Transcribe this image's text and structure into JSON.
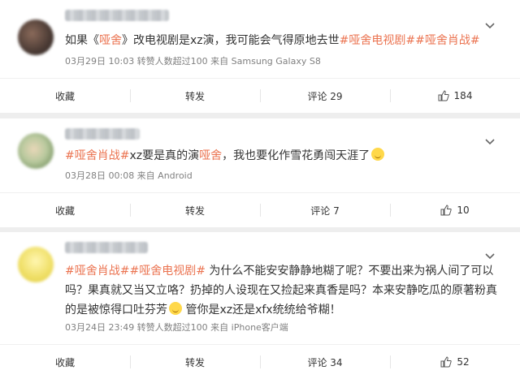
{
  "colors": {
    "tag": "#eb7350",
    "text": "#333333",
    "meta": "#808080"
  },
  "posts": [
    {
      "segments": [
        {
          "t": "如果《",
          "tag": false
        },
        {
          "t": "哑舍",
          "tag": true
        },
        {
          "t": "》改电视剧是xz演，我可能会气得原地去世",
          "tag": false
        },
        {
          "t": "#哑舍电视剧##哑舍肖战#",
          "tag": true
        }
      ],
      "meta": "03月29日 10:03 转赞人数超过100   来自 Samsung Galaxy S8",
      "actions": {
        "fav": "收藏",
        "repost": "转发",
        "comment": "评论 29",
        "like": "184"
      }
    },
    {
      "segments": [
        {
          "t": "#哑舍肖战#",
          "tag": true
        },
        {
          "t": "xz要是真的演",
          "tag": false
        },
        {
          "t": "哑舍",
          "tag": true
        },
        {
          "t": "，我也要化作雪花勇闯天涯了",
          "tag": false
        }
      ],
      "meta": "03月28日 00:08  来自 Android",
      "actions": {
        "fav": "收藏",
        "repost": "转发",
        "comment": "评论 7",
        "like": "10"
      }
    },
    {
      "segments": [
        {
          "t": "#哑舍肖战##哑舍电视剧#",
          "tag": true
        },
        {
          "t": " 为什么不能安安静静地糊了呢？不要出来为祸人间了可以吗？果真就又当又立咯？扔掉的人设现在又捡起来真香是吗？本来安静吃瓜的原著粉真的是被惊得口吐芬芳",
          "tag": false
        },
        {
          "t": " 管你是xz还是xfx统统给爷糊！",
          "tag": false
        }
      ],
      "meta": "03月24日 23:49 转赞人数超过100   来自 iPhone客户端",
      "actions": {
        "fav": "收藏",
        "repost": "转发",
        "comment": "评论 34",
        "like": "52"
      }
    }
  ]
}
